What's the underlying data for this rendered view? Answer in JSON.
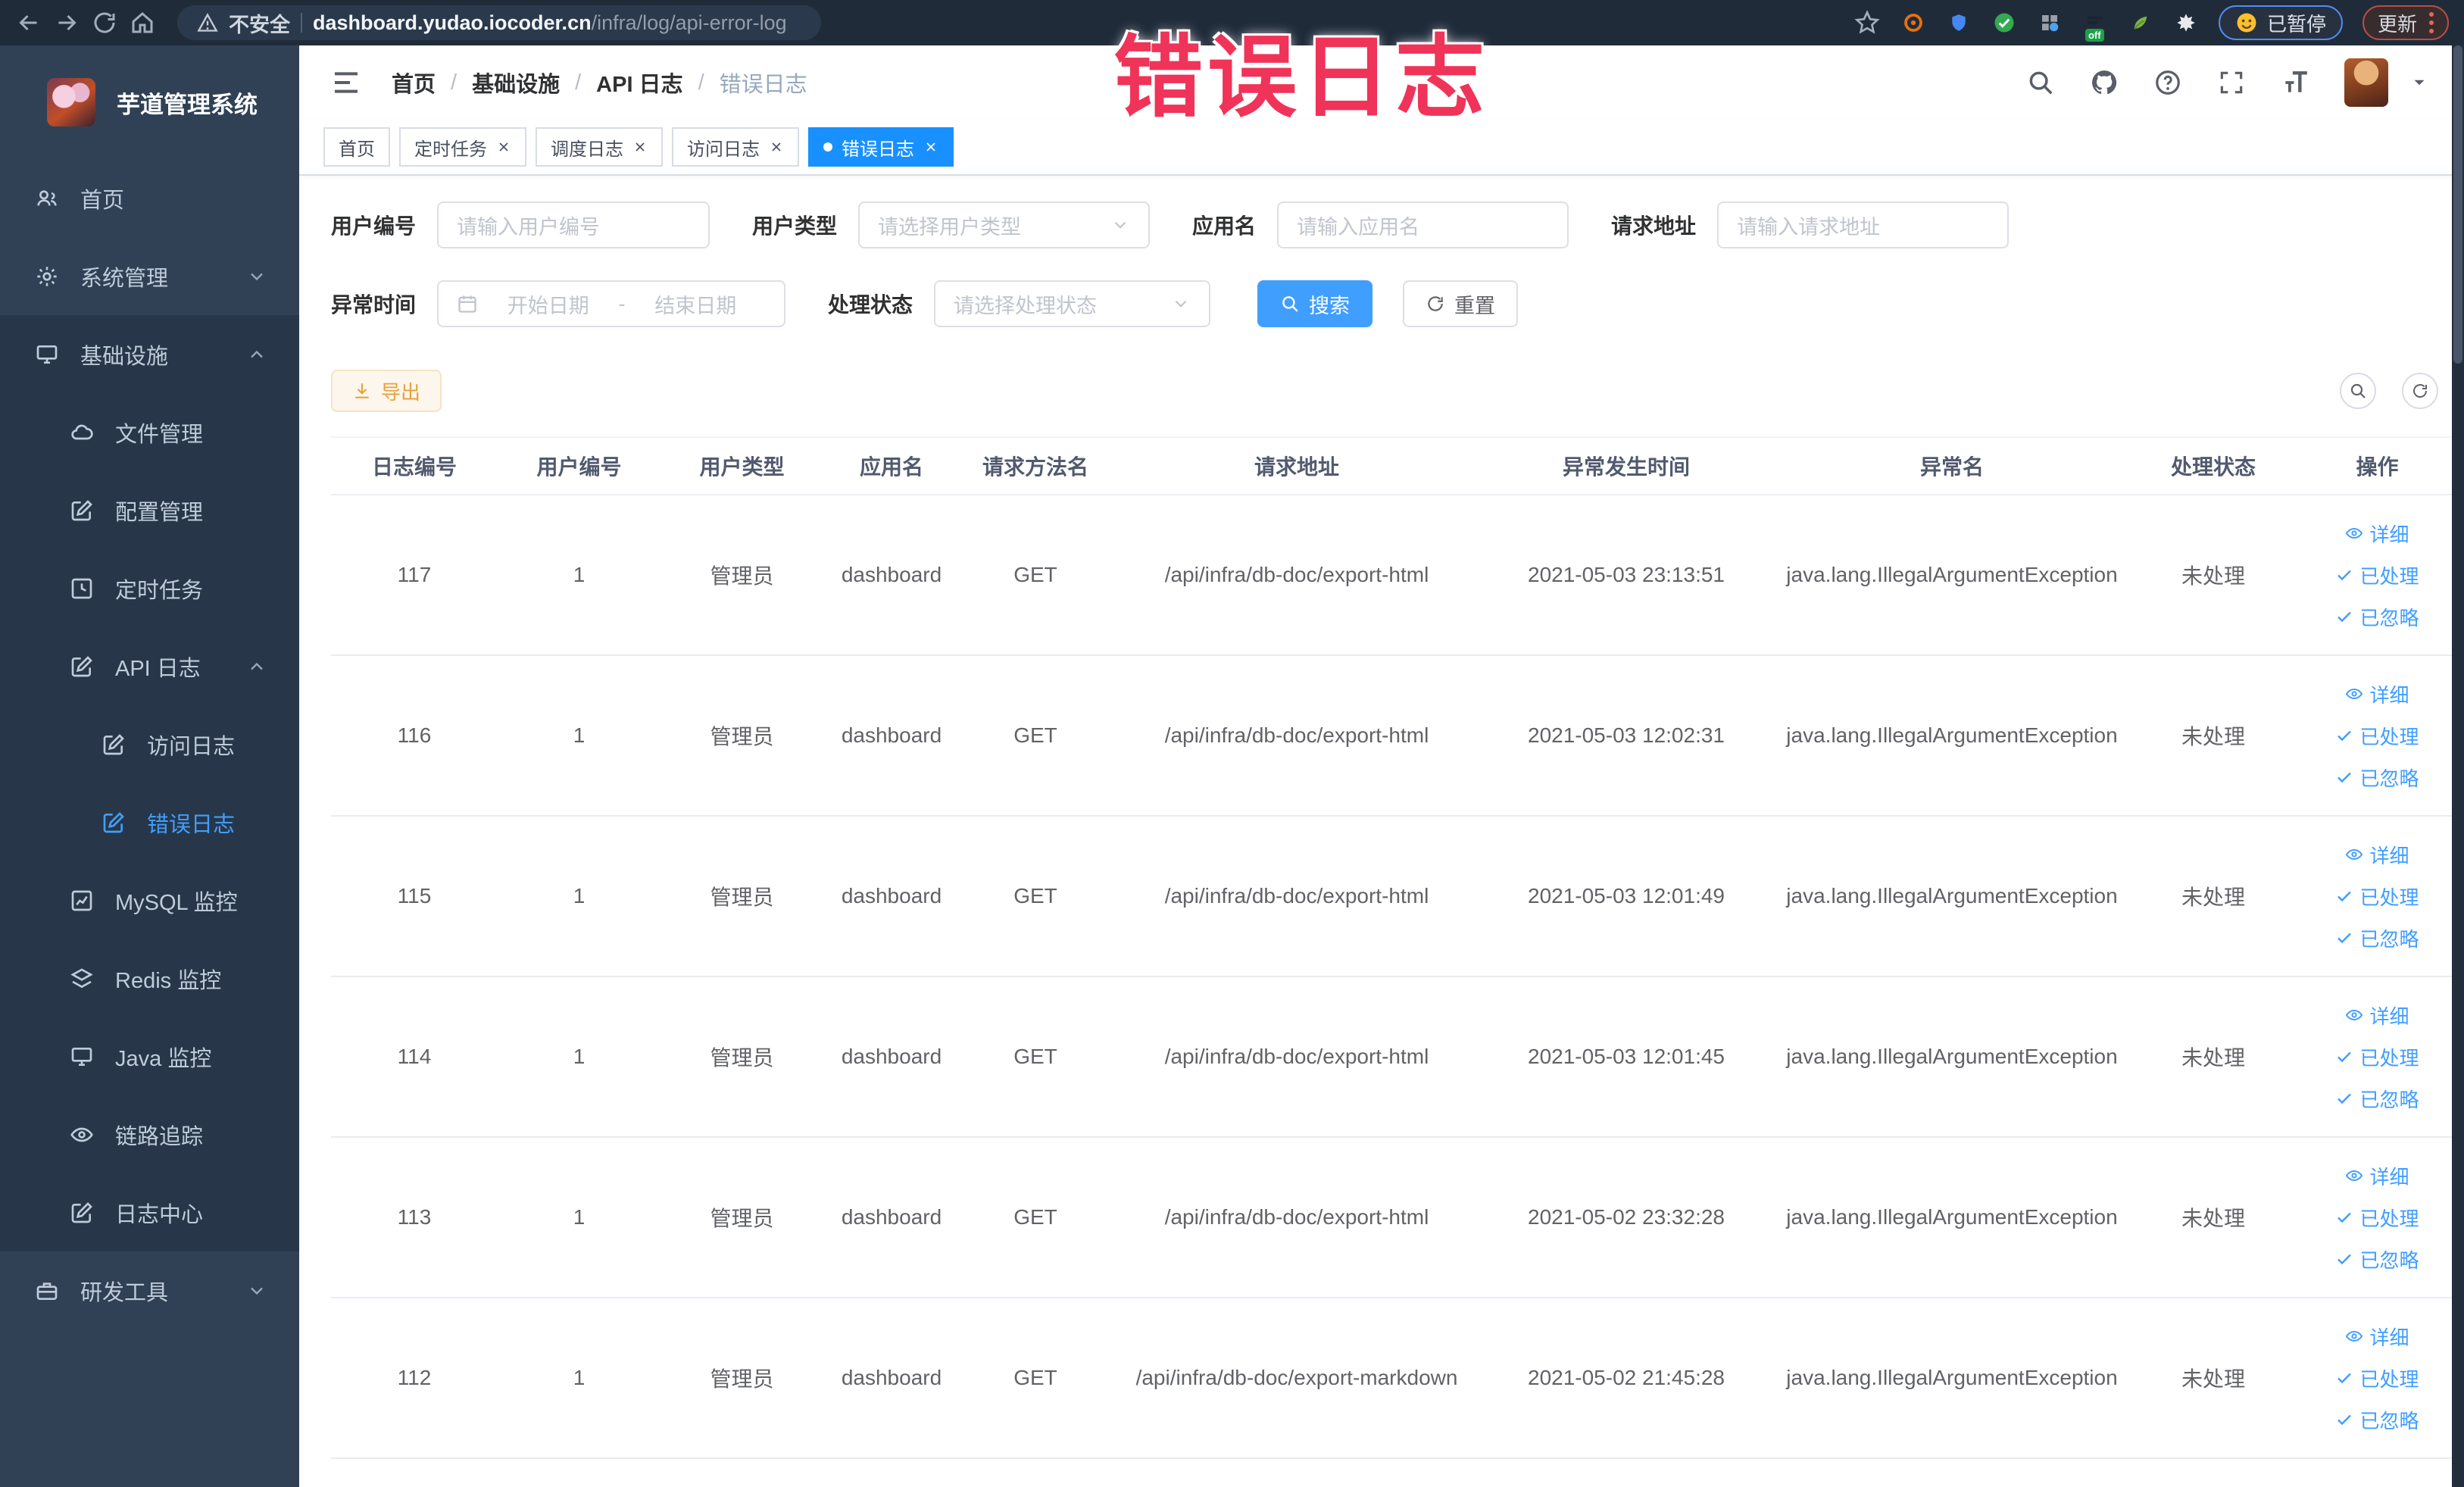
{
  "browser": {
    "security_label": "不安全",
    "url_domain": "dashboard.yudao.iocoder.cn",
    "url_path": "/infra/log/api-error-log",
    "paused_badge": "已暂停",
    "update_label": "更新",
    "off_badge": "off"
  },
  "overlay_title": "错误日志",
  "sidebar": {
    "logo_title": "芋道管理系统",
    "items": [
      {
        "label": "首页"
      },
      {
        "label": "系统管理"
      },
      {
        "label": "基础设施"
      },
      {
        "label": "文件管理"
      },
      {
        "label": "配置管理"
      },
      {
        "label": "定时任务"
      },
      {
        "label": "API 日志"
      },
      {
        "label": "访问日志"
      },
      {
        "label": "错误日志"
      },
      {
        "label": "MySQL 监控"
      },
      {
        "label": "Redis 监控"
      },
      {
        "label": "Java 监控"
      },
      {
        "label": "链路追踪"
      },
      {
        "label": "日志中心"
      },
      {
        "label": "研发工具"
      }
    ]
  },
  "breadcrumb": {
    "items": [
      "首页",
      "基础设施",
      "API 日志",
      "错误日志"
    ],
    "separator": "/"
  },
  "tabs": [
    {
      "label": "首页"
    },
    {
      "label": "定时任务"
    },
    {
      "label": "调度日志"
    },
    {
      "label": "访问日志"
    },
    {
      "label": "错误日志"
    }
  ],
  "filters": {
    "user_id_label": "用户编号",
    "user_id_placeholder": "请输入用户编号",
    "user_type_label": "用户类型",
    "user_type_placeholder": "请选择用户类型",
    "app_name_label": "应用名",
    "app_name_placeholder": "请输入应用名",
    "request_url_label": "请求地址",
    "request_url_placeholder": "请输入请求地址",
    "exception_time_label": "异常时间",
    "date_start_placeholder": "开始日期",
    "date_separator": "-",
    "date_end_placeholder": "结束日期",
    "process_status_label": "处理状态",
    "process_status_placeholder": "请选择处理状态",
    "search_button": "搜索",
    "reset_button": "重置"
  },
  "toolbar": {
    "export_button": "导出"
  },
  "table": {
    "columns": [
      "日志编号",
      "用户编号",
      "用户类型",
      "应用名",
      "请求方法名",
      "请求地址",
      "异常发生时间",
      "异常名",
      "处理状态",
      "操作"
    ],
    "row_actions": [
      "详细",
      "已处理",
      "已忽略"
    ],
    "rows": [
      {
        "id": "117",
        "user_id": "1",
        "user_type": "管理员",
        "app_name": "dashboard",
        "method": "GET",
        "url": "/api/infra/db-doc/export-html",
        "time": "2021-05-03 23:13:51",
        "exception": "java.lang.IllegalArgumentException",
        "status": "未处理"
      },
      {
        "id": "116",
        "user_id": "1",
        "user_type": "管理员",
        "app_name": "dashboard",
        "method": "GET",
        "url": "/api/infra/db-doc/export-html",
        "time": "2021-05-03 12:02:31",
        "exception": "java.lang.IllegalArgumentException",
        "status": "未处理"
      },
      {
        "id": "115",
        "user_id": "1",
        "user_type": "管理员",
        "app_name": "dashboard",
        "method": "GET",
        "url": "/api/infra/db-doc/export-html",
        "time": "2021-05-03 12:01:49",
        "exception": "java.lang.IllegalArgumentException",
        "status": "未处理"
      },
      {
        "id": "114",
        "user_id": "1",
        "user_type": "管理员",
        "app_name": "dashboard",
        "method": "GET",
        "url": "/api/infra/db-doc/export-html",
        "time": "2021-05-03 12:01:45",
        "exception": "java.lang.IllegalArgumentException",
        "status": "未处理"
      },
      {
        "id": "113",
        "user_id": "1",
        "user_type": "管理员",
        "app_name": "dashboard",
        "method": "GET",
        "url": "/api/infra/db-doc/export-html",
        "time": "2021-05-02 23:32:28",
        "exception": "java.lang.IllegalArgumentException",
        "status": "未处理"
      },
      {
        "id": "112",
        "user_id": "1",
        "user_type": "管理员",
        "app_name": "dashboard",
        "method": "GET",
        "url": "/api/infra/db-doc/export-markdown",
        "time": "2021-05-02 21:45:28",
        "exception": "java.lang.IllegalArgumentException",
        "status": "未处理"
      }
    ]
  },
  "colors": {
    "accent": "#409eff",
    "tab_active": "#1890ff",
    "warning": "#e6a23c",
    "overlay": "#f03358",
    "sidebar_bg": "#304156",
    "submenu_bg": "#273749",
    "chrome_bg": "#202b3a"
  }
}
